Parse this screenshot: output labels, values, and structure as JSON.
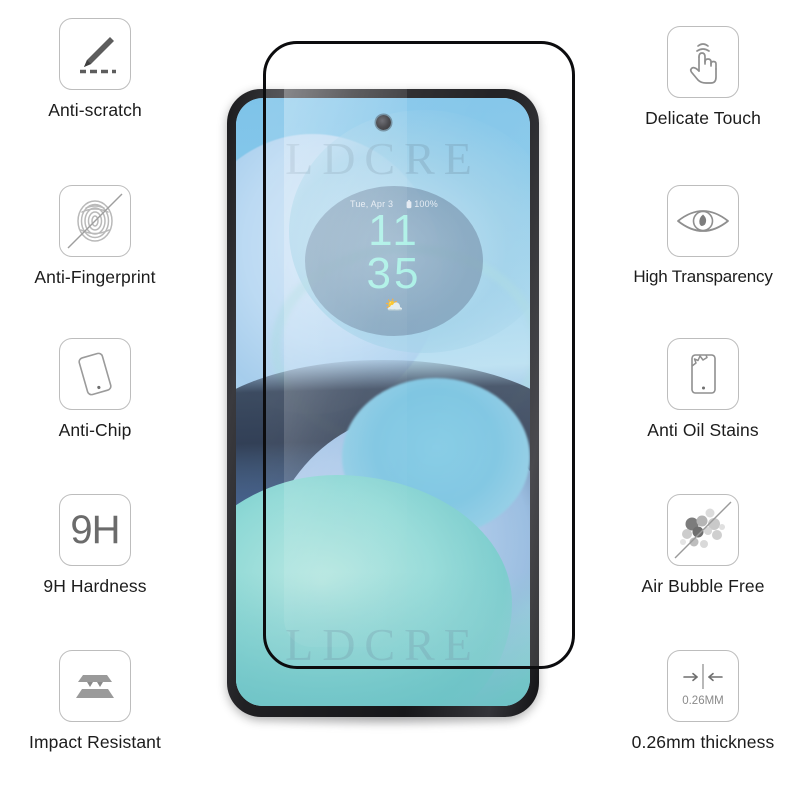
{
  "background_color": "#ffffff",
  "features_left": [
    {
      "icon": "pencil-scratch-icon",
      "label": "Anti-scratch"
    },
    {
      "icon": "fingerprint-crossed-icon",
      "label": "Anti-Fingerprint"
    },
    {
      "icon": "tilted-phone-icon",
      "label": "Anti-Chip"
    },
    {
      "icon": "hardness-9h-icon",
      "label": "9H Hardness",
      "icon_text": "9H"
    },
    {
      "icon": "impact-layers-icon",
      "label": "Impact Resistant"
    }
  ],
  "features_right": [
    {
      "icon": "touch-hand-icon",
      "label": "Delicate Touch"
    },
    {
      "icon": "eye-icon",
      "label": "High Transparency"
    },
    {
      "icon": "oil-stain-phone-icon",
      "label": "Anti Oil Stains"
    },
    {
      "icon": "bubbles-crossed-icon",
      "label": "Air Bubble Free"
    },
    {
      "icon": "thickness-arrows-icon",
      "label": "0.26mm thickness",
      "icon_text": "0.26MM"
    }
  ],
  "phone": {
    "watermark_top": "LDCRE",
    "watermark_bottom": "LDCRE",
    "clock": {
      "date": "Tue, Apr 3",
      "battery": "100%",
      "hours": "11",
      "minutes": "35",
      "weather_glyph": "⛅"
    }
  }
}
